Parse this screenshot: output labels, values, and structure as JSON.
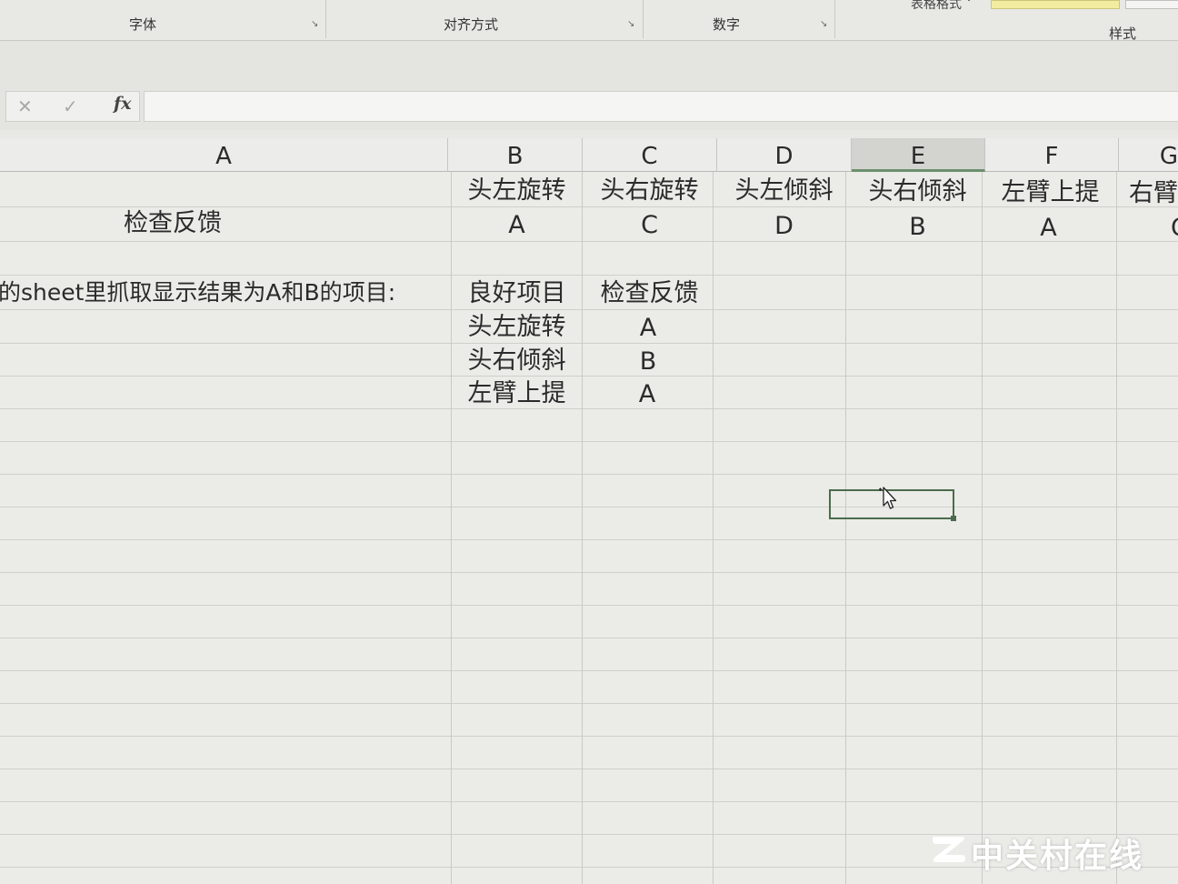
{
  "ribbon": {
    "groups": [
      {
        "label": "字体"
      },
      {
        "label": "对齐方式"
      },
      {
        "label": "数字"
      },
      {
        "label": "样式"
      }
    ],
    "table_format_label": "表格格式 ˅"
  },
  "formula_bar": {
    "cancel_glyph": "✕",
    "enter_glyph": "✓",
    "fx_label": "fx",
    "value": ""
  },
  "columns": [
    {
      "letter": "A"
    },
    {
      "letter": "B"
    },
    {
      "letter": "C"
    },
    {
      "letter": "D"
    },
    {
      "letter": "E",
      "selected": true
    },
    {
      "letter": "F"
    },
    {
      "letter": "G"
    }
  ],
  "sheet": {
    "row1": {
      "headers": [
        "头左旋转",
        "头右旋转",
        "头左倾斜",
        "头右倾斜",
        "左臂上提",
        "右臂"
      ]
    },
    "row2": {
      "label": "检查反馈",
      "values": [
        "A",
        "C",
        "D",
        "B",
        "A",
        "C"
      ]
    },
    "row4": {
      "instruction": "的sheet里抓取显示结果为A和B的项目:",
      "col_b": "良好项目",
      "col_c": "检查反馈"
    },
    "results": [
      {
        "item": "头左旋转",
        "feedback": "A"
      },
      {
        "item": "头右倾斜",
        "feedback": "B"
      },
      {
        "item": "左臂上提",
        "feedback": "A"
      }
    ]
  },
  "watermark": {
    "text": "中关村在线"
  },
  "colors": {
    "selection": "#4c6b4c",
    "grid_line": "#cfcfcc",
    "sheet_bg": "#ebebe8"
  },
  "icons": [
    "cancel-icon",
    "enter-icon",
    "fx-icon",
    "mouse-cursor-icon",
    "zol-logo-icon",
    "dialog-launcher-icon"
  ]
}
